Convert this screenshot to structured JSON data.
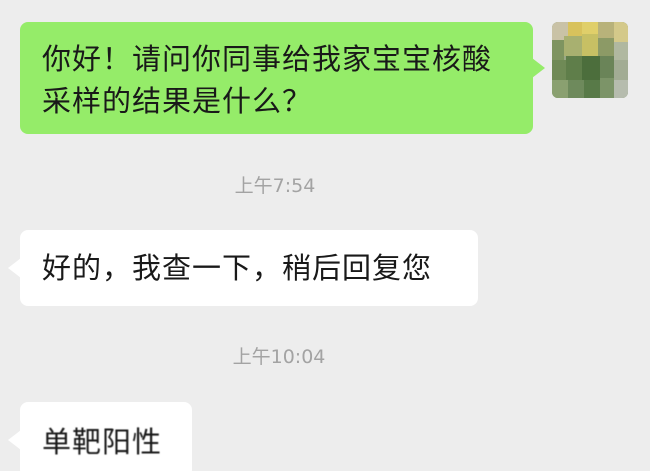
{
  "conversation": {
    "messages": [
      {
        "direction": "outgoing",
        "line1": "你好！请问你同事给我家宝宝核酸",
        "line2": "采样的结果是什么？"
      },
      {
        "direction": "incoming",
        "text": "好的，我查一下，稍后回复您"
      },
      {
        "direction": "incoming",
        "text": "单靶阳性"
      }
    ],
    "timestamps": [
      "上午7:54",
      "上午10:04"
    ]
  },
  "colors": {
    "background": "#ededed",
    "outgoing_bubble": "#95ec69",
    "incoming_bubble": "#ffffff",
    "timestamp_text": "#a3a3a3"
  },
  "icons": {
    "avatar": "user-avatar-photo"
  }
}
